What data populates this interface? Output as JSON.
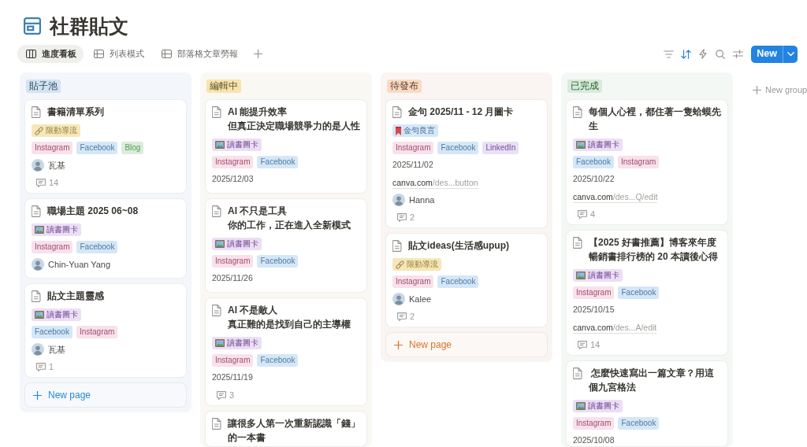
{
  "page": {
    "title": "社群貼文"
  },
  "views": [
    {
      "label": "進度看板",
      "kind": "board",
      "selected": true
    },
    {
      "label": "列表模式",
      "kind": "table",
      "selected": false
    },
    {
      "label": "部落格文章勞報",
      "kind": "table",
      "selected": false
    }
  ],
  "toolbar": [
    {
      "kind": "filter",
      "active": false
    },
    {
      "kind": "sort",
      "active": true
    },
    {
      "kind": "automation",
      "active": false
    },
    {
      "kind": "search",
      "active": false
    },
    {
      "kind": "settings",
      "active": false
    }
  ],
  "new_button": {
    "label": "New"
  },
  "columns": [
    {
      "label": "貼子池",
      "color": "#d3e3f0",
      "cards": [
        {
          "title": [
            "書籍清單系列"
          ],
          "category": {
            "label": "限動導流",
            "kind": "link",
            "color": "#f6e7b7"
          },
          "platforms": [
            {
              "label": "Instagram",
              "color": "#f8e1ea"
            },
            {
              "label": "Facebook",
              "color": "#d5e7f7"
            },
            {
              "label": "Blog",
              "color": "#dcebdd"
            }
          ],
          "person": "瓦基",
          "comments": "14"
        },
        {
          "title": [
            "職場主題 2025 06~08"
          ],
          "category": {
            "label": "讀書圖卡",
            "kind": "picture",
            "color": "#ebdff4"
          },
          "platforms": [
            {
              "label": "Instagram",
              "color": "#f8e1ea"
            },
            {
              "label": "Facebook",
              "color": "#d5e7f7"
            }
          ],
          "person": "Chin-Yuan Yang"
        },
        {
          "title": [
            "貼文主題靈感"
          ],
          "category": {
            "label": "讀書圖卡",
            "kind": "picture",
            "color": "#ebdff4"
          },
          "platforms": [
            {
              "label": "Facebook",
              "color": "#d5e7f7"
            },
            {
              "label": "Instagram",
              "color": "#f8e1ea"
            }
          ],
          "person": "瓦基",
          "comments": "1"
        }
      ],
      "new_page": "New page"
    },
    {
      "label": "編輯中",
      "color": "#f5e4ae",
      "cards": [
        {
          "title": [
            "AI 能提升效率",
            "但真正決定職場競爭力的是人性"
          ],
          "category": {
            "label": "讀書圖卡",
            "kind": "picture",
            "color": "#ebdff4"
          },
          "platforms": [
            {
              "label": "Instagram",
              "color": "#f8e1ea"
            },
            {
              "label": "Facebook",
              "color": "#d5e7f7"
            }
          ],
          "date": "2025/12/03"
        },
        {
          "title": [
            "AI 不只是工具",
            "你的工作，正在進入全新模式"
          ],
          "category": {
            "label": "讀書圖卡",
            "kind": "picture",
            "color": "#ebdff4"
          },
          "platforms": [
            {
              "label": "Instagram",
              "color": "#f8e1ea"
            },
            {
              "label": "Facebook",
              "color": "#d5e7f7"
            }
          ],
          "date": "2025/11/26"
        },
        {
          "title": [
            "AI 不是敵人",
            "真正難的是找到自己的主導權"
          ],
          "category": {
            "label": "讀書圖卡",
            "kind": "picture",
            "color": "#ebdff4"
          },
          "platforms": [
            {
              "label": "Instagram",
              "color": "#f8e1ea"
            },
            {
              "label": "Facebook",
              "color": "#d5e7f7"
            }
          ],
          "date": "2025/11/19",
          "comments": "3"
        },
        {
          "title": [
            "讓很多人第一次重新認識「錢」的一本書"
          ]
        }
      ]
    },
    {
      "label": "待發布",
      "color": "#f8dbc5",
      "cards": [
        {
          "title": [
            "金句 2025/11 - 12 月圖卡"
          ],
          "category": {
            "label": "金句良言",
            "kind": "bookmark",
            "color": "#d5e7f7"
          },
          "platforms": [
            {
              "label": "Instagram",
              "color": "#f8e1ea"
            },
            {
              "label": "Facebook",
              "color": "#d5e7f7"
            },
            {
              "label": "LinkedIn",
              "color": "#e9e0f4"
            }
          ],
          "date": "2025/11/02",
          "link": {
            "domain": "canva.com",
            "path": "/des...button"
          },
          "person": "Hanna",
          "comments": "2"
        },
        {
          "title": [
            "貼文ideas(生活感upup)"
          ],
          "category": {
            "label": "限動導流",
            "kind": "link",
            "color": "#f6e7b7"
          },
          "platforms": [
            {
              "label": "Instagram",
              "color": "#f8e1ea"
            },
            {
              "label": "Facebook",
              "color": "#d5e7f7"
            }
          ],
          "person": "Kalee",
          "comments": "2"
        }
      ],
      "new_page": "New page"
    },
    {
      "label": "已完成",
      "color": "#d8eadb",
      "cards": [
        {
          "title": [
            "每個人心裡，都住著一隻蛤蟆先生"
          ],
          "category": {
            "label": "讀書圖卡",
            "kind": "picture",
            "color": "#ebdff4"
          },
          "platforms": [
            {
              "label": "Facebook",
              "color": "#d5e7f7"
            },
            {
              "label": "Instagram",
              "color": "#f8e1ea"
            }
          ],
          "date": "2025/10/22",
          "link": {
            "domain": "canva.com",
            "path": "/des...Q/edit"
          },
          "comments": "4"
        },
        {
          "title": [
            "【2025 好書推薦】博客來年度暢銷書排行榜的 20 本讀後心得"
          ],
          "category": {
            "label": "讀書圖卡",
            "kind": "picture",
            "color": "#ebdff4"
          },
          "platforms": [
            {
              "label": "Instagram",
              "color": "#f8e1ea"
            },
            {
              "label": "Facebook",
              "color": "#d5e7f7"
            }
          ],
          "date": "2025/10/15",
          "link": {
            "domain": "canva.com",
            "path": "/des...A/edit"
          },
          "comments": "14"
        },
        {
          "title": [
            " 怎麼快速寫出一篇文章？用這個九宮格法"
          ],
          "category": {
            "label": "讀書圖卡",
            "kind": "picture",
            "color": "#ebdff4"
          },
          "platforms": [
            {
              "label": "Instagram",
              "color": "#f8e1ea"
            },
            {
              "label": "Facebook",
              "color": "#d5e7f7"
            }
          ],
          "date": "2025/10/08"
        }
      ]
    }
  ],
  "new_group": "New group"
}
